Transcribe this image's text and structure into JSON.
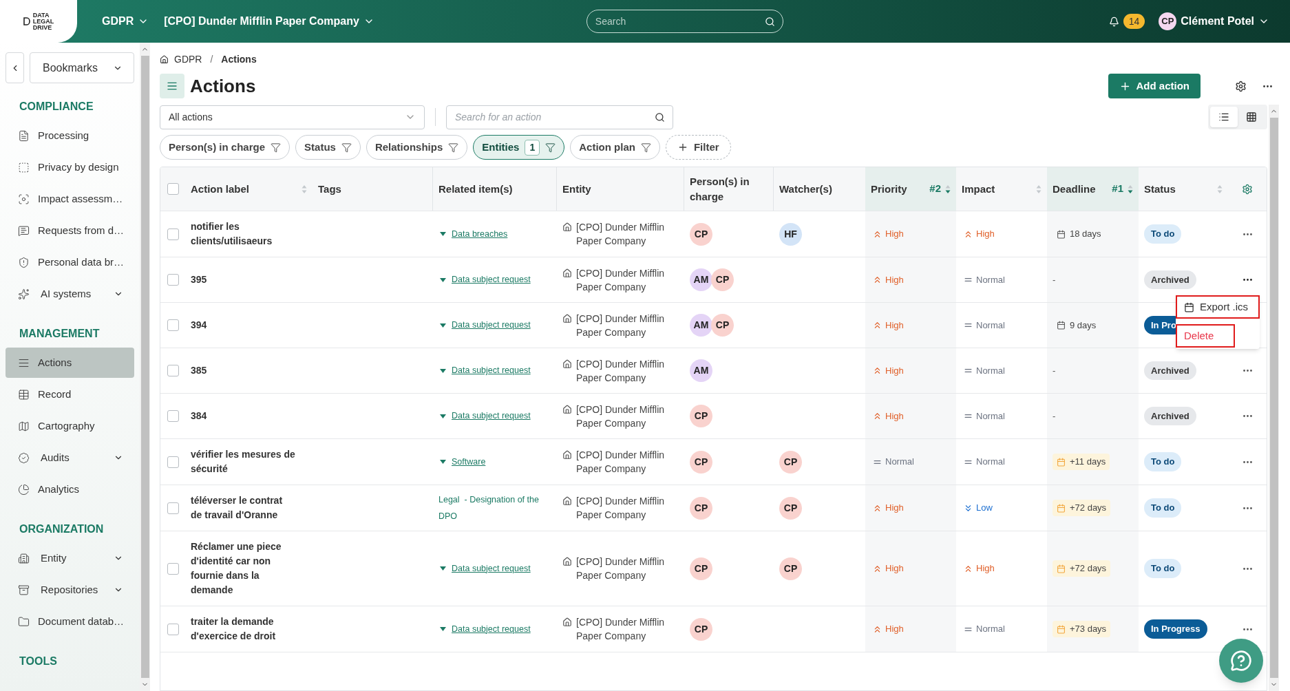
{
  "topbar": {
    "logo_lines": [
      "DATA",
      "LEGAL",
      "DRIVE"
    ],
    "module": "GDPR",
    "organization": "[CPO] Dunder Mifflin Paper Company",
    "search_placeholder": "Search",
    "notifications": "14",
    "user_initials": "CP",
    "user_name": "Clément Potel"
  },
  "sidebar": {
    "bookmarks": "Bookmarks",
    "sections": [
      {
        "title": "COMPLIANCE",
        "items": [
          {
            "label": "Processing",
            "kind": "file",
            "expandable": false,
            "selected": false
          },
          {
            "label": "Privacy by design",
            "kind": "dashed",
            "expandable": false,
            "selected": false
          },
          {
            "label": "Impact assessm…",
            "kind": "focus",
            "expandable": false,
            "selected": false
          },
          {
            "label": "Requests from d…",
            "kind": "message",
            "expandable": false,
            "selected": false
          },
          {
            "label": "Personal data br…",
            "kind": "shield",
            "expandable": false,
            "selected": false
          },
          {
            "label": "AI systems",
            "kind": "sparkles",
            "expandable": true,
            "selected": false
          }
        ]
      },
      {
        "title": "MANAGEMENT",
        "items": [
          {
            "label": "Actions",
            "kind": "lines",
            "expandable": false,
            "selected": true
          },
          {
            "label": "Record",
            "kind": "table",
            "expandable": false,
            "selected": false
          },
          {
            "label": "Cartography",
            "kind": "map",
            "expandable": false,
            "selected": false
          },
          {
            "label": "Audits",
            "kind": "badge",
            "expandable": true,
            "selected": false
          },
          {
            "label": "Analytics",
            "kind": "pie",
            "expandable": false,
            "selected": false
          }
        ]
      },
      {
        "title": "ORGANIZATION",
        "items": [
          {
            "label": "Entity",
            "kind": "building",
            "expandable": true,
            "selected": false
          },
          {
            "label": "Repositories",
            "kind": "archive",
            "expandable": true,
            "selected": false
          },
          {
            "label": "Document datab…",
            "kind": "folder",
            "expandable": false,
            "selected": false
          }
        ]
      },
      {
        "title": "TOOLS"
      }
    ]
  },
  "breadcrumb": [
    "GDPR",
    "Actions"
  ],
  "breadcrumb_separator": "/",
  "title": "Actions",
  "add_button": "Add action",
  "view_select": "All actions",
  "search_placeholder": "Search for an action",
  "filters": [
    {
      "label": "Person(s) in charge",
      "active": false
    },
    {
      "label": "Status",
      "active": false
    },
    {
      "label": "Relationships",
      "active": false
    },
    {
      "label": "Entities",
      "count": "1",
      "active": true
    },
    {
      "label": "Action plan",
      "active": false
    }
  ],
  "add_filter": "Filter",
  "view_modes": [
    {
      "kind": "list",
      "selected": true
    },
    {
      "kind": "grid",
      "selected": false
    }
  ],
  "select_all_checked": false,
  "columns": [
    {
      "label": "Action label",
      "sortable": true,
      "sorted": false
    },
    {
      "label": "Tags",
      "sortable": false,
      "sorted": false
    },
    {
      "label": "Related item(s)",
      "sortable": false,
      "sorted": false
    },
    {
      "label": "Entity",
      "sortable": false,
      "sorted": false
    },
    {
      "label": "Person(s) in charge",
      "sortable": false,
      "sorted": false
    },
    {
      "label": "Watcher(s)",
      "sortable": false,
      "sorted": false
    },
    {
      "label": "Priority",
      "sortable": true,
      "sorted": true,
      "rank": "#2"
    },
    {
      "label": "Impact",
      "sortable": true,
      "sorted": false
    },
    {
      "label": "Deadline",
      "sortable": true,
      "sorted": true,
      "rank": "#1"
    },
    {
      "label": "Status",
      "sortable": true,
      "sorted": false
    }
  ],
  "rows": [
    {
      "checked": false,
      "menu_open": false,
      "label": "notifier les clients/utilisaeurs",
      "related": {
        "kind": "link",
        "text": "Data breaches"
      },
      "entity": "[CPO] Dunder Mifflin Paper Company",
      "persons": [
        {
          "initials": "CP",
          "color": "#f9d2ce"
        }
      ],
      "watchers": [
        {
          "initials": "HF",
          "color": "#d3e4f7"
        }
      ],
      "priority": {
        "kind": "high",
        "text": "High"
      },
      "impact": {
        "kind": "high",
        "text": "High"
      },
      "deadline": {
        "kind": "due",
        "text": "18 days"
      },
      "status": {
        "kind": "todo",
        "text": "To do"
      }
    },
    {
      "checked": false,
      "menu_open": true,
      "label": "395",
      "related": {
        "kind": "link",
        "text": "Data subject request"
      },
      "entity": "[CPO] Dunder Mifflin Paper Company",
      "persons": [
        {
          "initials": "AM",
          "color": "#e4d4f6"
        },
        {
          "initials": "CP",
          "color": "#f9d2ce"
        }
      ],
      "watchers": [],
      "priority": {
        "kind": "high",
        "text": "High"
      },
      "impact": {
        "kind": "normal",
        "text": "Normal"
      },
      "deadline": {
        "kind": "none",
        "text": "-"
      },
      "status": {
        "kind": "archived",
        "text": "Archived"
      }
    },
    {
      "checked": false,
      "menu_open": false,
      "label": "394",
      "related": {
        "kind": "link",
        "text": "Data subject request"
      },
      "entity": "[CPO] Dunder Mifflin Paper Company",
      "persons": [
        {
          "initials": "AM",
          "color": "#e4d4f6"
        },
        {
          "initials": "CP",
          "color": "#f9d2ce"
        }
      ],
      "watchers": [],
      "priority": {
        "kind": "high",
        "text": "High"
      },
      "impact": {
        "kind": "normal",
        "text": "Normal"
      },
      "deadline": {
        "kind": "due",
        "text": "9 days"
      },
      "status": {
        "kind": "progress",
        "text": "In Pro"
      }
    },
    {
      "checked": false,
      "menu_open": false,
      "label": "385",
      "related": {
        "kind": "link",
        "text": "Data subject request"
      },
      "entity": "[CPO] Dunder Mifflin Paper Company",
      "persons": [
        {
          "initials": "AM",
          "color": "#e4d4f6"
        }
      ],
      "watchers": [],
      "priority": {
        "kind": "high",
        "text": "High"
      },
      "impact": {
        "kind": "normal",
        "text": "Normal"
      },
      "deadline": {
        "kind": "none",
        "text": "-"
      },
      "status": {
        "kind": "archived",
        "text": "Archived"
      }
    },
    {
      "checked": false,
      "menu_open": false,
      "label": "384",
      "related": {
        "kind": "link",
        "text": "Data subject request"
      },
      "entity": "[CPO] Dunder Mifflin Paper Company",
      "persons": [
        {
          "initials": "CP",
          "color": "#f9d2ce"
        }
      ],
      "watchers": [],
      "priority": {
        "kind": "high",
        "text": "High"
      },
      "impact": {
        "kind": "normal",
        "text": "Normal"
      },
      "deadline": {
        "kind": "none",
        "text": "-"
      },
      "status": {
        "kind": "archived",
        "text": "Archived"
      }
    },
    {
      "checked": false,
      "menu_open": false,
      "label": "vérifier les mesures de sécurité",
      "related": {
        "kind": "link",
        "text": "Software"
      },
      "entity": "[CPO] Dunder Mifflin Paper Company",
      "persons": [
        {
          "initials": "CP",
          "color": "#f9d2ce"
        }
      ],
      "watchers": [
        {
          "initials": "CP",
          "color": "#f9d2ce"
        }
      ],
      "priority": {
        "kind": "normal",
        "text": "Normal"
      },
      "impact": {
        "kind": "normal",
        "text": "Normal"
      },
      "deadline": {
        "kind": "upcoming",
        "text": "+11 days"
      },
      "status": {
        "kind": "todo",
        "text": "To do"
      }
    },
    {
      "checked": false,
      "menu_open": false,
      "label": "téléverser le contrat de travail d'Oranne",
      "related": {
        "kind": "text",
        "text": "Legal  - Designation of the DPO"
      },
      "entity": "[CPO] Dunder Mifflin Paper Company",
      "persons": [
        {
          "initials": "CP",
          "color": "#f9d2ce"
        }
      ],
      "watchers": [
        {
          "initials": "CP",
          "color": "#f9d2ce"
        }
      ],
      "priority": {
        "kind": "high",
        "text": "High"
      },
      "impact": {
        "kind": "low",
        "text": "Low"
      },
      "deadline": {
        "kind": "upcoming",
        "text": "+72 days"
      },
      "status": {
        "kind": "todo",
        "text": "To do"
      }
    },
    {
      "checked": false,
      "menu_open": false,
      "label": "Réclamer une piece d'identité car non fournie dans la demande",
      "related": {
        "kind": "link",
        "text": "Data subject request"
      },
      "entity": "[CPO] Dunder Mifflin Paper Company",
      "persons": [
        {
          "initials": "CP",
          "color": "#f9d2ce"
        }
      ],
      "watchers": [
        {
          "initials": "CP",
          "color": "#f9d2ce"
        }
      ],
      "priority": {
        "kind": "high",
        "text": "High"
      },
      "impact": {
        "kind": "high",
        "text": "High"
      },
      "deadline": {
        "kind": "upcoming",
        "text": "+72 days"
      },
      "status": {
        "kind": "todo",
        "text": "To do"
      }
    },
    {
      "checked": false,
      "menu_open": false,
      "label": "traiter la demande d'exercice de droit",
      "related": {
        "kind": "link",
        "text": "Data subject request"
      },
      "entity": "[CPO] Dunder Mifflin Paper Company",
      "persons": [
        {
          "initials": "CP",
          "color": "#f9d2ce"
        }
      ],
      "watchers": [],
      "priority": {
        "kind": "high",
        "text": "High"
      },
      "impact": {
        "kind": "normal",
        "text": "Normal"
      },
      "deadline": {
        "kind": "upcoming",
        "text": "+73 days"
      },
      "status": {
        "kind": "progress",
        "text": "In Progress"
      }
    }
  ],
  "row_menu": {
    "items": [
      {
        "kind": "export",
        "label": "Export .ics",
        "highlighted": true
      },
      {
        "kind": "delete",
        "label": "Delete",
        "highlighted": true
      }
    ]
  }
}
